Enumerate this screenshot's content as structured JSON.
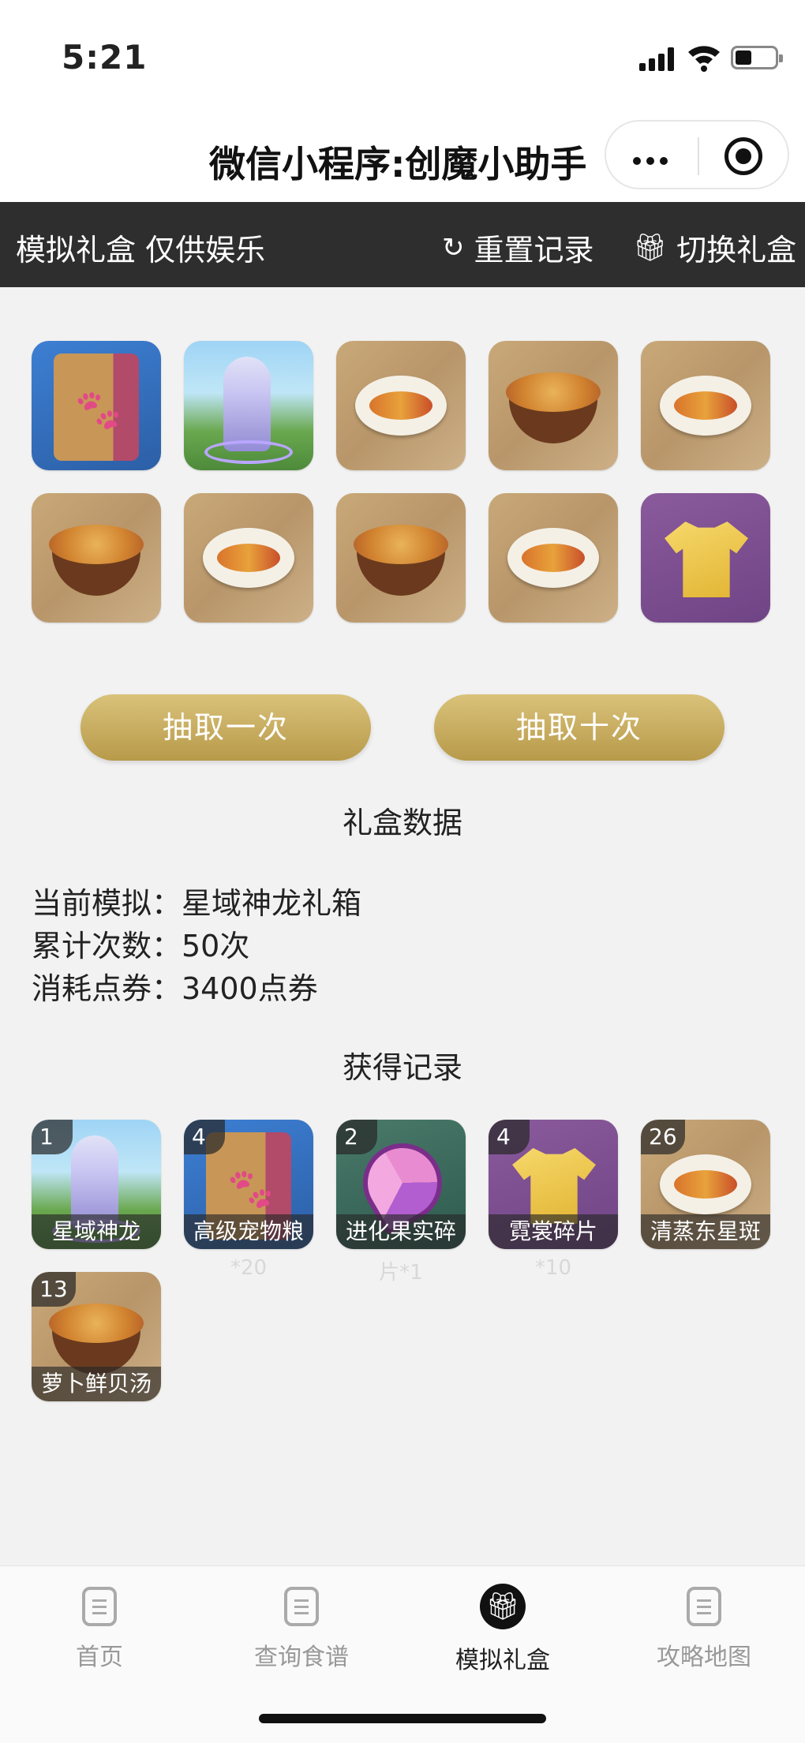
{
  "status_bar": {
    "time": "5:21"
  },
  "nav": {
    "title": "微信小程序:创魔小助手"
  },
  "header": {
    "title": "模拟礼盒 仅供娱乐",
    "reset_label": "重置记录",
    "switch_label": "切换礼盒"
  },
  "result_grid": [
    {
      "icon": "pet-food-bag-icon",
      "style": "blue"
    },
    {
      "icon": "star-dragon-icon",
      "style": "scene"
    },
    {
      "icon": "steamed-fish-icon",
      "style": "wood"
    },
    {
      "icon": "soup-bowl-icon",
      "style": "wood"
    },
    {
      "icon": "steamed-fish-icon",
      "style": "wood"
    },
    {
      "icon": "soup-bowl-icon",
      "style": "wood"
    },
    {
      "icon": "steamed-fish-icon",
      "style": "wood"
    },
    {
      "icon": "soup-bowl-icon",
      "style": "wood"
    },
    {
      "icon": "steamed-fish-icon",
      "style": "wood"
    },
    {
      "icon": "shirt-icon",
      "style": "purple"
    }
  ],
  "buttons": {
    "draw_once": "抽取一次",
    "draw_ten": "抽取十次"
  },
  "stats": {
    "title": "礼盒数据",
    "current": "当前模拟：星域神龙礼箱",
    "count": "累计次数：50次",
    "cost": "消耗点券：3400点券"
  },
  "records": {
    "title": "获得记录",
    "items": [
      {
        "count": "1",
        "label": "星域神龙",
        "sub": "",
        "icon": "star-dragon-icon"
      },
      {
        "count": "4",
        "label": "高级宠物粮",
        "sub": "*20",
        "icon": "pet-food-bag-icon"
      },
      {
        "count": "2",
        "label": "进化果实碎",
        "sub": "片*1",
        "icon": "evolution-fruit-icon"
      },
      {
        "count": "4",
        "label": "霓裳碎片",
        "sub": "*10",
        "icon": "shirt-icon"
      },
      {
        "count": "26",
        "label": "清蒸东星斑",
        "sub": "",
        "icon": "steamed-fish-icon"
      },
      {
        "count": "13",
        "label": "萝卜鲜贝汤",
        "sub": "",
        "icon": "soup-bowl-icon"
      }
    ]
  },
  "tabs": [
    {
      "label": "首页",
      "icon": "document-icon"
    },
    {
      "label": "查询食谱",
      "icon": "document-icon"
    },
    {
      "label": "模拟礼盒",
      "icon": "gift-icon",
      "active": true
    },
    {
      "label": "攻略地图",
      "icon": "document-icon"
    }
  ]
}
